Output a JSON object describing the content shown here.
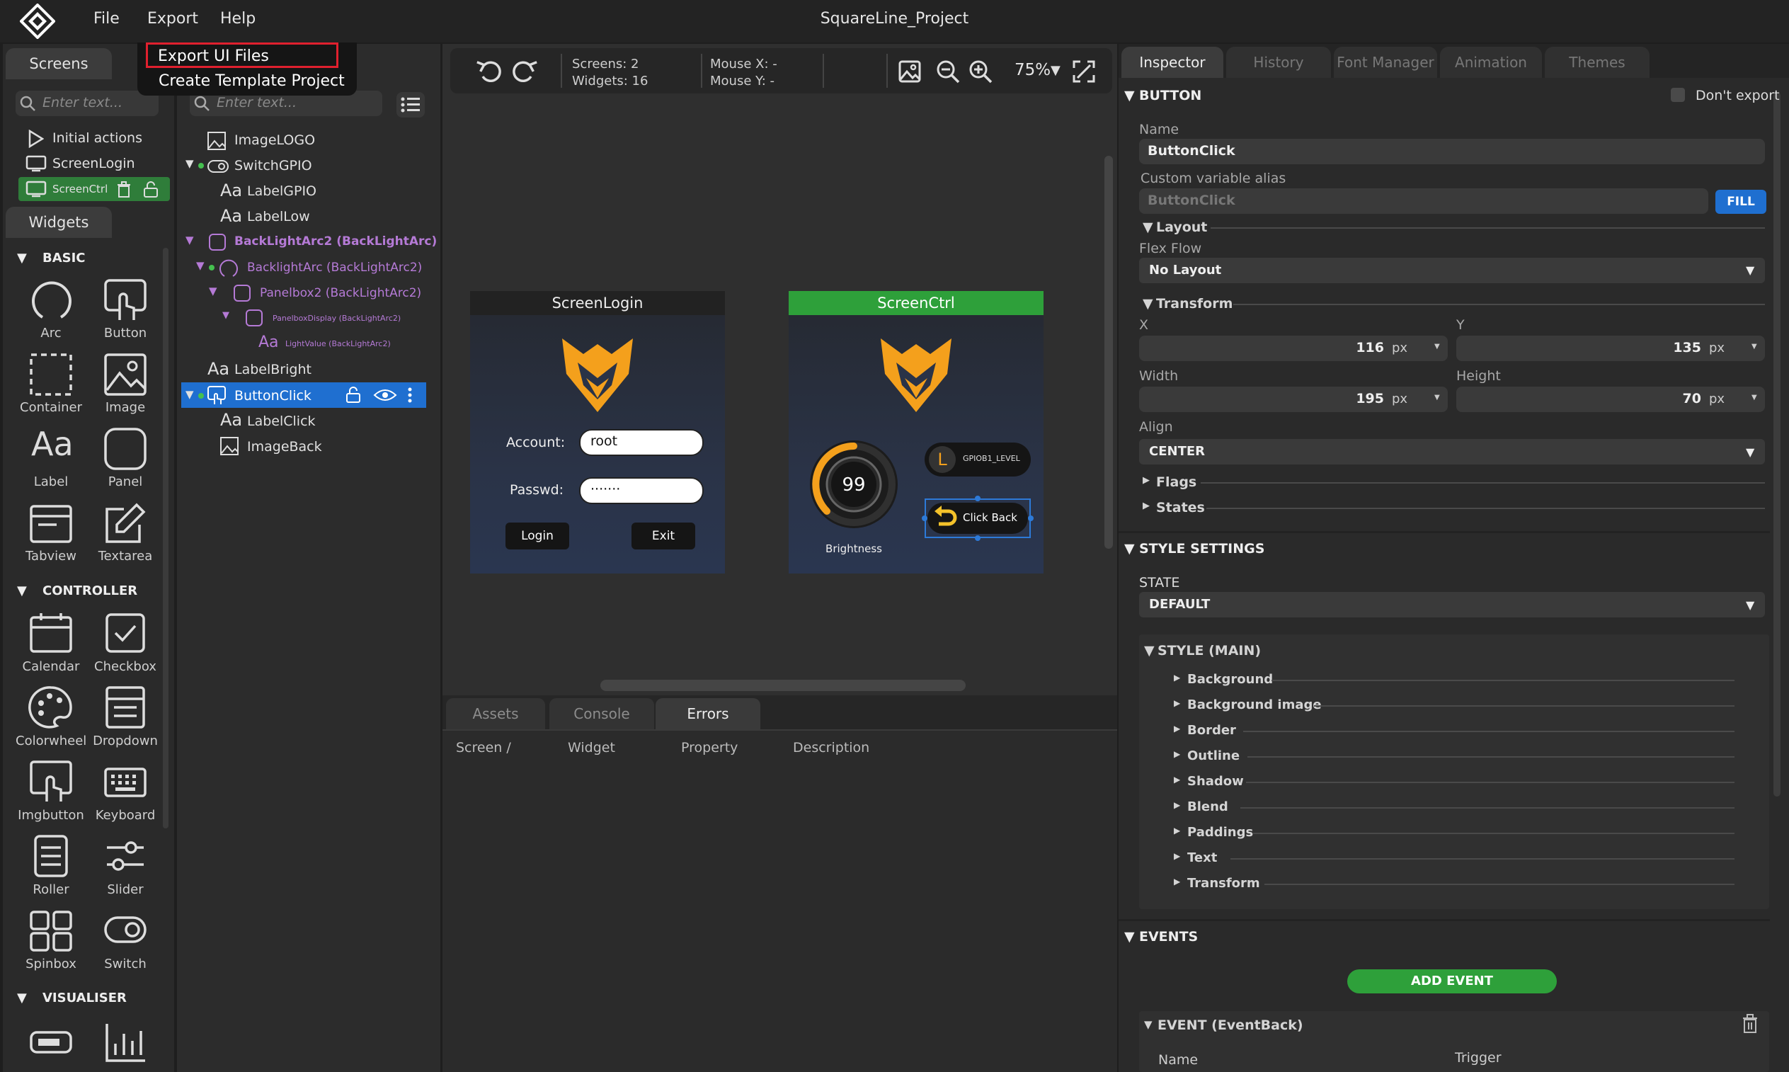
{
  "app": {
    "title": "SquareLine_Project",
    "menu": [
      "File",
      "Export",
      "Help"
    ],
    "export_menu": [
      "Export UI Files",
      "Create Template Project"
    ]
  },
  "screens_panel": {
    "tab": "Screens",
    "search_placeholder": "Enter text...",
    "items": [
      "Initial actions",
      "ScreenLogin",
      "ScreenCtrl"
    ]
  },
  "hierarchy": {
    "search_placeholder": "Enter text...",
    "items": [
      "ImageLOGO",
      "SwitchGPIO",
      "LabelGPIO",
      "LabelLow",
      "BackLightArc2 (BackLightArc)",
      "BacklightArc (BackLightArc2)",
      "Panelbox2 (BackLightArc2)",
      "PanelboxDisplay (BackLightArc2)",
      "LightValue (BackLightArc2)",
      "LabelBright",
      "ButtonClick",
      "LabelClick",
      "ImageBack"
    ]
  },
  "widgets": {
    "tab": "Widgets",
    "sections": {
      "basic": {
        "title": "BASIC",
        "items": [
          "Arc",
          "Button",
          "Container",
          "Image",
          "Label",
          "Panel",
          "Tabview",
          "Textarea"
        ]
      },
      "controller": {
        "title": "CONTROLLER",
        "items": [
          "Calendar",
          "Checkbox",
          "Colorwheel",
          "Dropdown",
          "Imgbutton",
          "Keyboard",
          "Roller",
          "Slider",
          "Spinbox",
          "Switch"
        ]
      },
      "visualiser": {
        "title": "VISUALISER"
      }
    }
  },
  "toolbar": {
    "screens": "Screens:  2",
    "widgets": "Widgets:  16",
    "mouse_x": "Mouse X:  -",
    "mouse_y": "Mouse Y:  -",
    "zoom": "75%"
  },
  "screen_login": {
    "title": "ScreenLogin",
    "account_label": "Account:",
    "account_value": "root",
    "passwd_label": "Passwd:",
    "passwd_value": "·······",
    "login": "Login",
    "exit": "Exit"
  },
  "screen_ctrl": {
    "title": "ScreenCtrl",
    "arc_value": "99",
    "brightness": "Brightness",
    "switch_label": "GPIOB1_LEVEL",
    "switch_letter": "L",
    "click_back": "Click Back"
  },
  "bottom": {
    "tabs": [
      "Assets",
      "Console",
      "Errors"
    ],
    "columns": [
      "Screen /",
      "Widget",
      "Property",
      "Description"
    ]
  },
  "inspector": {
    "tabs": [
      "Inspector",
      "History",
      "Font Manager",
      "Animation",
      "Themes"
    ],
    "button_section": "BUTTON",
    "dont_export": "Don't export",
    "name_label": "Name",
    "name_value": "ButtonClick",
    "alias_label": "Custom variable alias",
    "alias_value": "ButtonClick",
    "fill": "FILL",
    "layout": "Layout",
    "flex_flow_label": "Flex Flow",
    "flex_flow_value": "No Layout",
    "transform": "Transform",
    "x_label": "X",
    "x_value": "116",
    "y_label": "Y",
    "y_value": "135",
    "width_label": "Width",
    "width_value": "195",
    "height_label": "Height",
    "height_value": "70",
    "unit": "px",
    "align_label": "Align",
    "align_value": "CENTER",
    "flags": "Flags",
    "states": "States",
    "style_settings": "STYLE SETTINGS",
    "state_label": "STATE",
    "state_value": "DEFAULT",
    "style_main": "STYLE (MAIN)",
    "style_items": [
      "Background",
      "Background image",
      "Border",
      "Outline",
      "Shadow",
      "Blend",
      "Paddings",
      "Text",
      "Transform"
    ],
    "events": "EVENTS",
    "add_event": "ADD EVENT",
    "event_item": "EVENT (EventBack)",
    "event_name_col": "Name",
    "event_trigger_col": "Trigger"
  },
  "colors": {
    "accent_green": "#2ea03a",
    "accent_orange": "#f4a01c",
    "fill_blue": "#1f6fd0",
    "selected_blue": "#1f6fd0",
    "purple": "#b57ad6"
  }
}
